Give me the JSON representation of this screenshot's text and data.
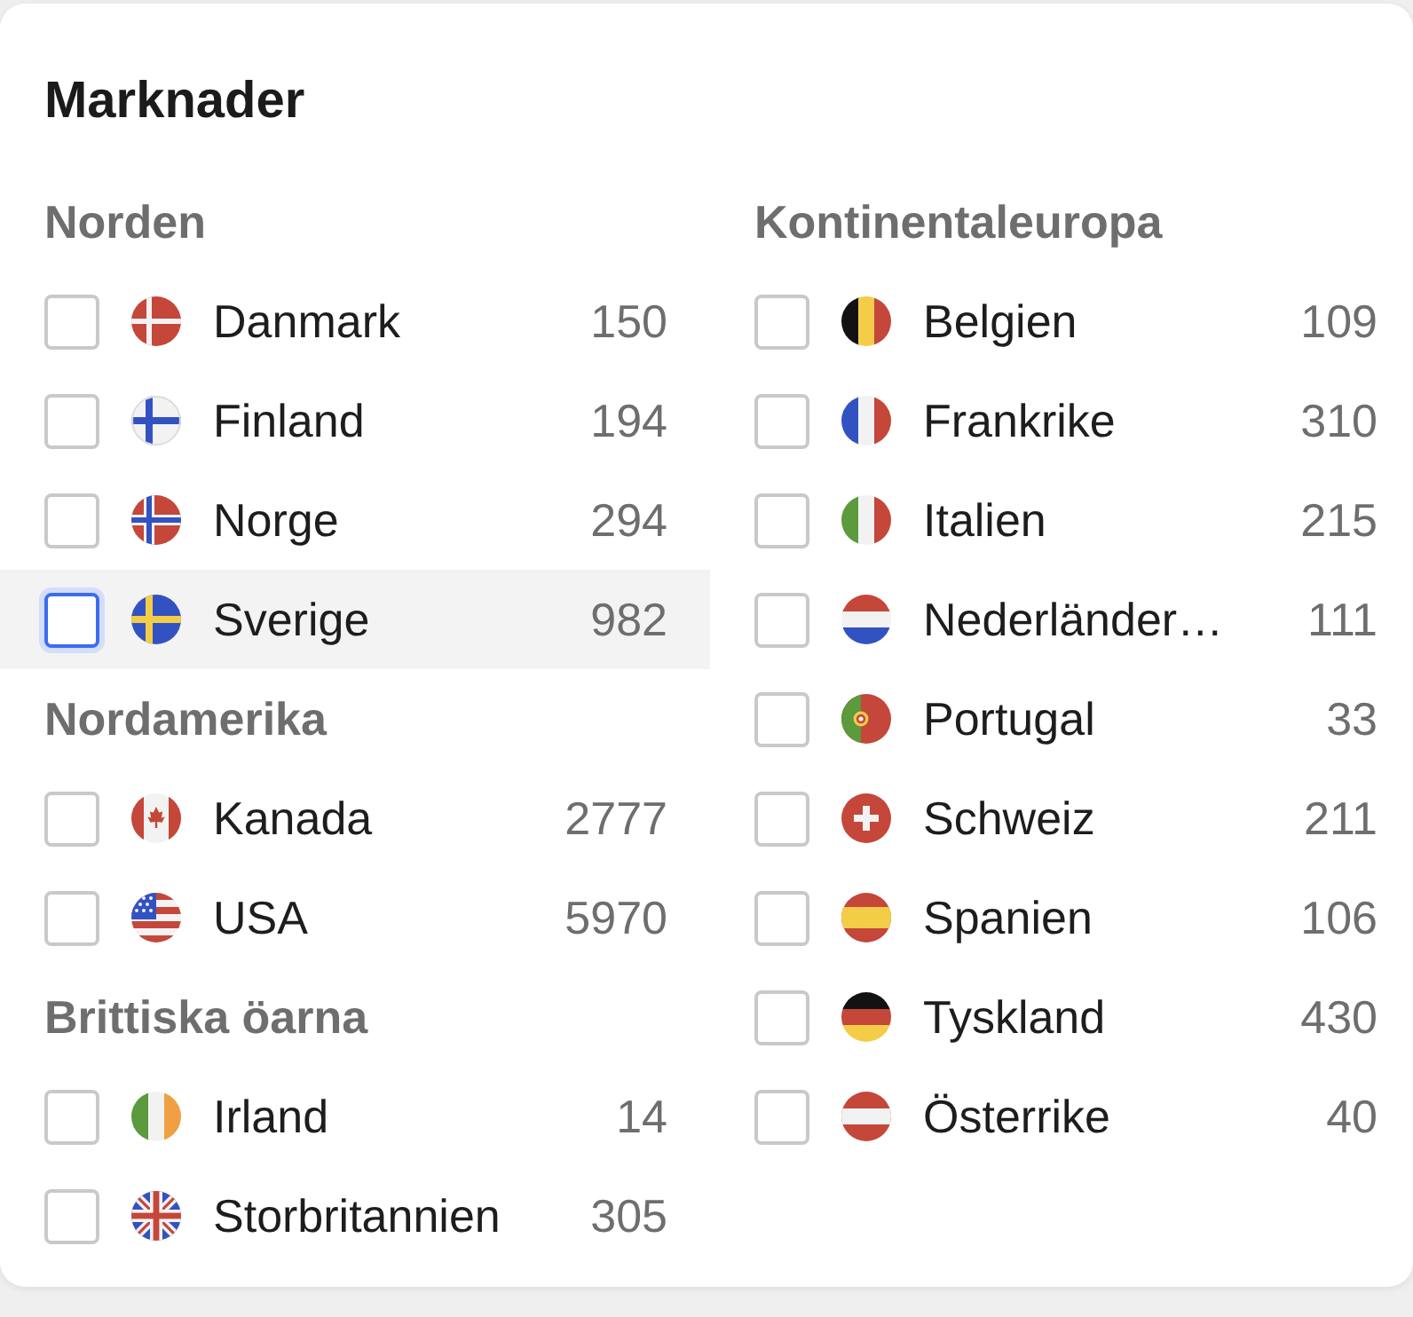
{
  "panel": {
    "title": "Marknader",
    "columns": [
      {
        "groups": [
          {
            "heading": "Norden",
            "markets": [
              {
                "name": "Danmark",
                "count": "150",
                "kind": "dk",
                "checked": false,
                "focused": false
              },
              {
                "name": "Finland",
                "count": "194",
                "kind": "fi",
                "checked": false,
                "focused": false
              },
              {
                "name": "Norge",
                "count": "294",
                "kind": "no",
                "checked": false,
                "focused": false
              },
              {
                "name": "Sverige",
                "count": "982",
                "kind": "se",
                "checked": false,
                "focused": true
              }
            ]
          },
          {
            "heading": "Nordamerika",
            "markets": [
              {
                "name": "Kanada",
                "count": "2777",
                "kind": "ca",
                "checked": false,
                "focused": false
              },
              {
                "name": "USA",
                "count": "5970",
                "kind": "us",
                "checked": false,
                "focused": false
              }
            ]
          },
          {
            "heading": "Brittiska öarna",
            "markets": [
              {
                "name": "Irland",
                "count": "14",
                "kind": "ie",
                "checked": false,
                "focused": false
              },
              {
                "name": "Storbritannien",
                "count": "305",
                "kind": "gb",
                "checked": false,
                "focused": false
              }
            ]
          }
        ]
      },
      {
        "groups": [
          {
            "heading": "Kontinentaleuropa",
            "markets": [
              {
                "name": "Belgien",
                "count": "109",
                "kind": "be",
                "checked": false,
                "focused": false
              },
              {
                "name": "Frankrike",
                "count": "310",
                "kind": "fr",
                "checked": false,
                "focused": false
              },
              {
                "name": "Italien",
                "count": "215",
                "kind": "it",
                "checked": false,
                "focused": false
              },
              {
                "name": "Nederländer…",
                "count": "111",
                "kind": "nl",
                "checked": false,
                "focused": false
              },
              {
                "name": "Portugal",
                "count": "33",
                "kind": "pt",
                "checked": false,
                "focused": false
              },
              {
                "name": "Schweiz",
                "count": "211",
                "kind": "ch",
                "checked": false,
                "focused": false
              },
              {
                "name": "Spanien",
                "count": "106",
                "kind": "es",
                "checked": false,
                "focused": false
              },
              {
                "name": "Tyskland",
                "count": "430",
                "kind": "de",
                "checked": false,
                "focused": false
              },
              {
                "name": "Österrike",
                "count": "40",
                "kind": "at",
                "checked": false,
                "focused": false
              }
            ]
          }
        ]
      }
    ]
  }
}
